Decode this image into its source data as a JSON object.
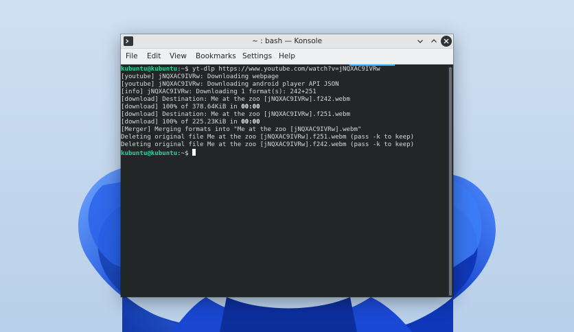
{
  "window": {
    "title": "~ : bash — Konsole"
  },
  "menu": [
    "File",
    "Edit",
    "View",
    "Bookmarks",
    "Settings",
    "Help"
  ],
  "terminal": {
    "prompt": "kubuntu@kubuntu",
    "prompt_suffix": ":~$ ",
    "command": "yt-dlp https://www.youtube.com/watch?v=jNQXAC9IVRw",
    "lines": [
      "[youtube] jNQXAC9IVRw: Downloading webpage",
      "[youtube] jNQXAC9IVRw: Downloading android player API JSON",
      "[info] jNQXAC9IVRw: Downloading 1 format(s): 242+251",
      "[download] Destination: Me at the zoo [jNQXAC9IVRw].f242.webm"
    ],
    "progress1": {
      "text": "[download] 100% of 378.64KiB in ",
      "time": "00:00"
    },
    "line_dest2": "[download] Destination: Me at the zoo [jNQXAC9IVRw].f251.webm",
    "progress2": {
      "text": "[download] 100% of 225.23KiB in ",
      "time": "00:00"
    },
    "tail_lines": [
      "[Merger] Merging formats into \"Me at the zoo [jNQXAC9IVRw].webm\"",
      "Deleting original file Me at the zoo [jNQXAC9IVRw].f251.webm (pass -k to keep)",
      "Deleting original file Me at the zoo [jNQXAC9IVRw].f242.webm (pass -k to keep)"
    ]
  },
  "colors": {
    "prompt": "#1cdc9a",
    "terminal_bg": "#232627",
    "accent": "#3daee9",
    "wallpaper_blue": "#1f55e0"
  },
  "icons": {
    "app": "konsole-icon",
    "minimize": "chevron-down-icon",
    "maximize": "chevron-up-icon",
    "close": "close-icon"
  }
}
